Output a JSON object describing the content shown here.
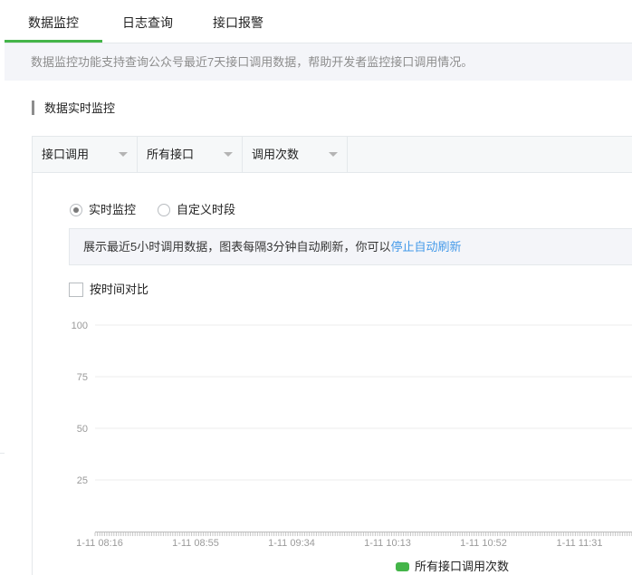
{
  "tabs": [
    {
      "label": "数据监控",
      "active": true
    },
    {
      "label": "日志查询",
      "active": false
    },
    {
      "label": "接口报警",
      "active": false
    }
  ],
  "description": "数据监控功能支持查询公众号最近7天接口调用数据，帮助开发者监控接口调用情况。",
  "section_title": "数据实时监控",
  "filters": [
    {
      "selected": "接口调用"
    },
    {
      "selected": "所有接口"
    },
    {
      "selected": "调用次数"
    }
  ],
  "mode": {
    "realtime_label": "实时监控",
    "custom_label": "自定义时段",
    "selected": "realtime"
  },
  "notice": {
    "text": "展示最近5小时调用数据，图表每隔3分钟自动刷新，你可以",
    "link": "停止自动刷新"
  },
  "compare_checkbox": {
    "label": "按时间对比",
    "checked": false
  },
  "colors": {
    "accent": "#44b549",
    "link": "#459ae9",
    "grid": "#eeeeee"
  },
  "chart_data": {
    "type": "line",
    "ylim": [
      0,
      100
    ],
    "y_ticks": [
      "100",
      "75",
      "50",
      "25"
    ],
    "x_ticks": [
      "1-11 08:16",
      "1-11 08:55",
      "1-11 09:34",
      "1-11 10:13",
      "1-11 10:52",
      "1-11 11:31"
    ],
    "series": [
      {
        "name": "所有接口调用次数",
        "color": "#44b549",
        "values": []
      }
    ],
    "legend": "bottom"
  }
}
